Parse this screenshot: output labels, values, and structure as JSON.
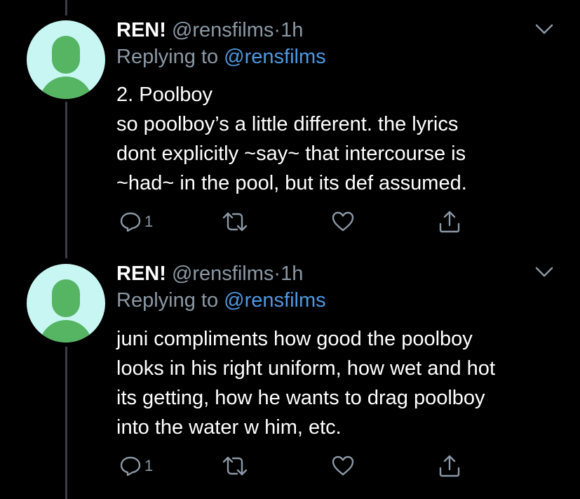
{
  "colors": {
    "background": "#000000",
    "text": "#ffffff",
    "muted": "#8b98a5",
    "mention": "#4f98e0",
    "avatar_bg": "#c8f6f2",
    "avatar_fg": "#55b563",
    "thread_line": "#3a3d41"
  },
  "tweets": [
    {
      "name": "REN!",
      "handle": "@rensfilms",
      "separator": "·",
      "time": "1h",
      "replying_prefix": "Replying to",
      "replying_mention": "@rensfilms",
      "lines": [
        "2. Poolboy",
        "so poolboy’s a little different. the lyrics",
        "dont explicitly ~say~ that intercourse is",
        "~had~ in the pool, but its def assumed."
      ],
      "reply_count": "1",
      "icons": [
        "reply-icon",
        "retweet-icon",
        "like-icon",
        "share-icon",
        "chevron-down-icon"
      ]
    },
    {
      "name": "REN!",
      "handle": "@rensfilms",
      "separator": "·",
      "time": "1h",
      "replying_prefix": "Replying to",
      "replying_mention": "@rensfilms",
      "lines": [
        "juni compliments how good the poolboy",
        "looks in his right uniform, how wet and hot",
        "its getting, how he wants to drag poolboy",
        "into the water w him, etc."
      ],
      "reply_count": "1",
      "icons": [
        "reply-icon",
        "retweet-icon",
        "like-icon",
        "share-icon",
        "chevron-down-icon"
      ]
    }
  ]
}
